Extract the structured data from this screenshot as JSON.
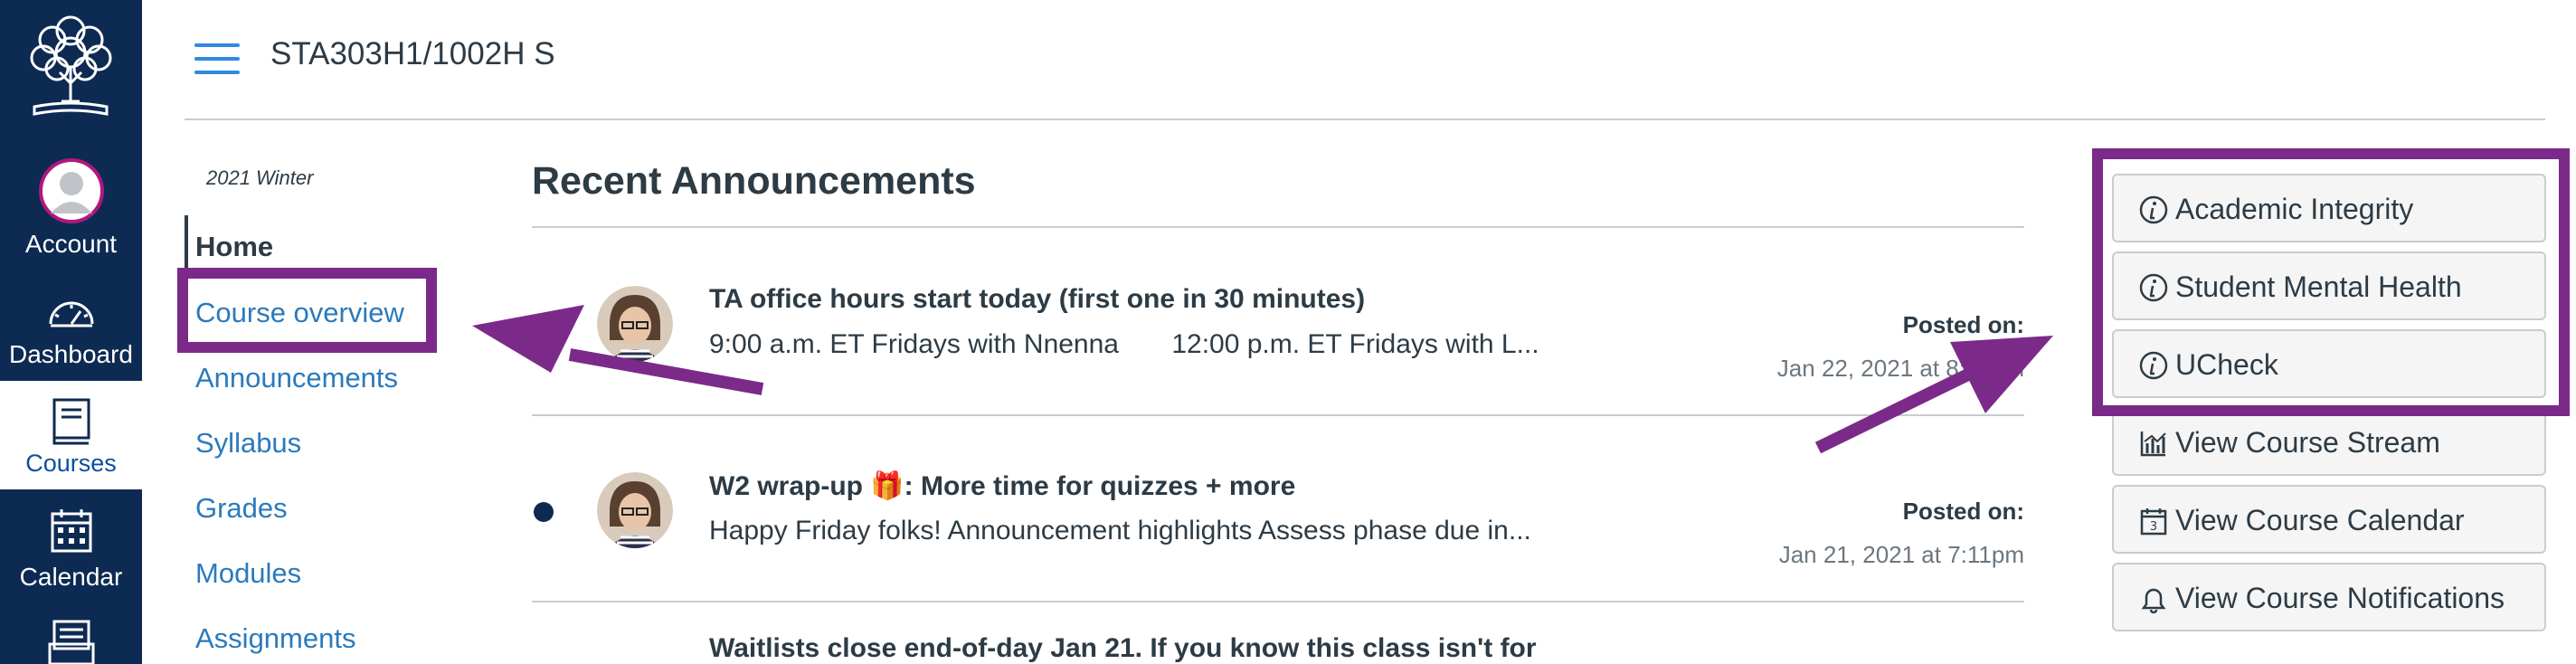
{
  "global_nav": {
    "account_label": "Account",
    "dashboard_label": "Dashboard",
    "courses_label": "Courses",
    "calendar_label": "Calendar"
  },
  "header": {
    "course_code": "STA303H1/1002H S"
  },
  "course_nav": {
    "term": "2021 Winter",
    "items": [
      {
        "label": "Home"
      },
      {
        "label": "Course overview"
      },
      {
        "label": "Announcements"
      },
      {
        "label": "Syllabus"
      },
      {
        "label": "Grades"
      },
      {
        "label": "Modules"
      },
      {
        "label": "Assignments"
      }
    ]
  },
  "announcements": {
    "title": "Recent Announcements",
    "items": [
      {
        "heading": "TA office hours start today (first one in 30 minutes)",
        "message": "9:00 a.m. ET Fridays with Nnenna       12:00 p.m. ET Fridays with L...",
        "posted_label": "Posted on:",
        "date": "Jan 22, 2021 at 8:20am"
      },
      {
        "heading": "W2 wrap-up 🎁: More time for quizzes + more",
        "message": "Happy Friday folks! Announcement highlights Assess phase due in...",
        "posted_label": "Posted on:",
        "date": "Jan 21, 2021 at 7:11pm"
      },
      {
        "heading": "Waitlists close end-of-day Jan 21. If you know this class isn't for"
      }
    ]
  },
  "sidebar": {
    "buttons": [
      {
        "label": "Academic Integrity",
        "icon": "info-icon"
      },
      {
        "label": "Student Mental Health",
        "icon": "info-icon"
      },
      {
        "label": "UCheck",
        "icon": "info-icon"
      },
      {
        "label": "View Course Stream",
        "icon": "stream-chart-icon"
      },
      {
        "label": "View Course Calendar",
        "icon": "calendar-icon"
      },
      {
        "label": "View Course Notifications",
        "icon": "bell-icon"
      }
    ]
  },
  "colors": {
    "rail": "#0d2a52",
    "link": "#2b7abc",
    "annotation": "#7b2a8a"
  }
}
